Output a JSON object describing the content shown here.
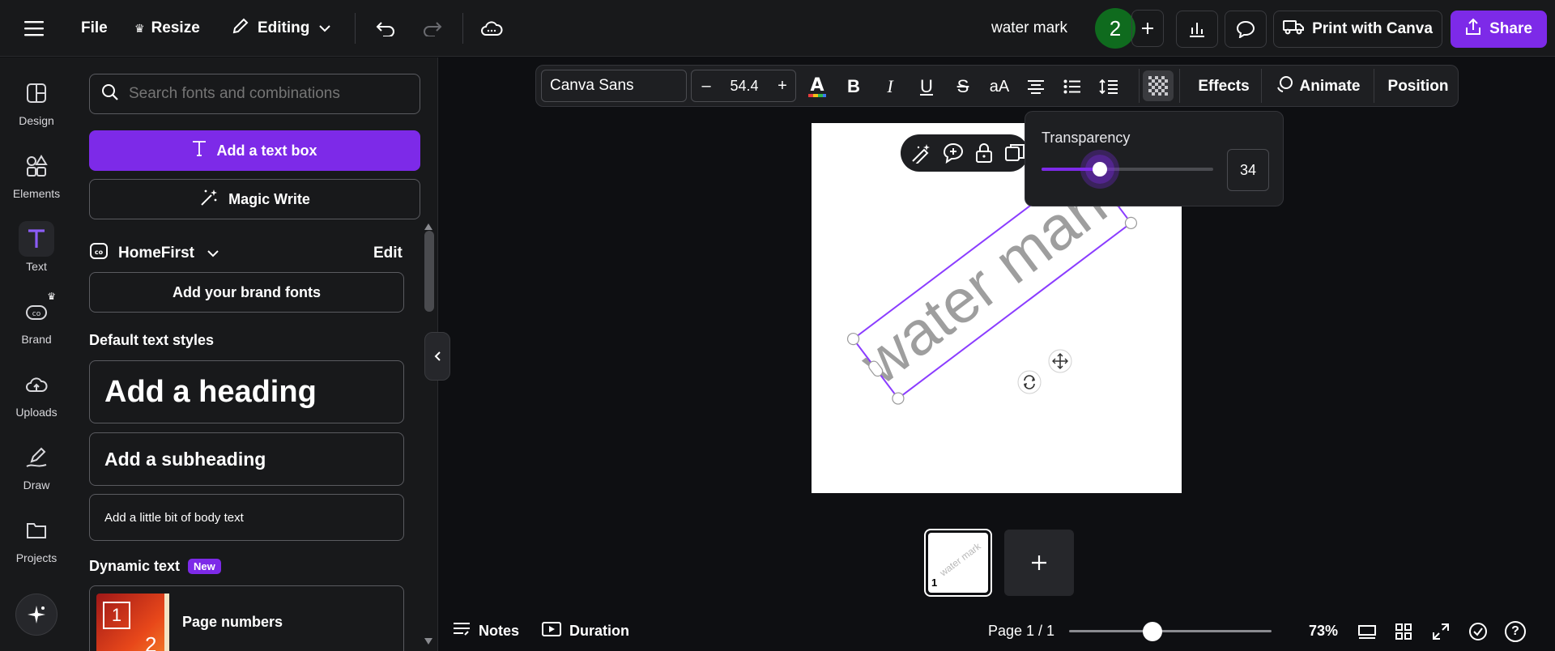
{
  "topbar": {
    "file_label": "File",
    "resize_label": "Resize",
    "editing_label": "Editing",
    "doc_title": "water mark",
    "collab_count": "2",
    "print_label": "Print with Canva",
    "share_label": "Share",
    "share_color": "#7d2ae8"
  },
  "rail": {
    "items": [
      {
        "label": "Design",
        "icon": "design-icon"
      },
      {
        "label": "Elements",
        "icon": "elements-icon"
      },
      {
        "label": "Text",
        "icon": "text-icon"
      },
      {
        "label": "Brand",
        "icon": "brand-icon"
      },
      {
        "label": "Uploads",
        "icon": "uploads-icon"
      },
      {
        "label": "Draw",
        "icon": "draw-icon"
      },
      {
        "label": "Projects",
        "icon": "projects-icon"
      }
    ]
  },
  "panel": {
    "search_placeholder": "Search fonts and combinations",
    "add_text_box": "Add a text box",
    "magic_write": "Magic Write",
    "brand_kit": "HomeFirst",
    "edit_label": "Edit",
    "add_brand_fonts": "Add your brand fonts",
    "default_styles_title": "Default text styles",
    "heading": "Add a heading",
    "subheading": "Add a subheading",
    "body": "Add a little bit of body text",
    "dynamic_title": "Dynamic text",
    "new_badge": "New",
    "page_numbers": "Page numbers",
    "thumb_number": "1",
    "thumb_number2": "2"
  },
  "toolbar": {
    "font_name": "Canva Sans",
    "font_size": "54.4",
    "minus": "–",
    "plus": "+",
    "bold": "B",
    "italic": "I",
    "underline": "U",
    "strike": "S",
    "case": "aA",
    "effects": "Effects",
    "animate": "Animate",
    "position": "Position"
  },
  "transparency": {
    "title": "Transparency",
    "value": "34",
    "level_percent": 34,
    "accent": "#7d2ae8"
  },
  "canvas": {
    "watermark_text": "water mark",
    "watermark_color": "#8a8a8a",
    "thumb_page_number": "1",
    "thumb_text": "water mark"
  },
  "bottombar": {
    "notes": "Notes",
    "duration": "Duration",
    "page_indicator": "Page 1 / 1",
    "zoom": "73%",
    "zoom_level_percent": 73,
    "help": "?"
  }
}
